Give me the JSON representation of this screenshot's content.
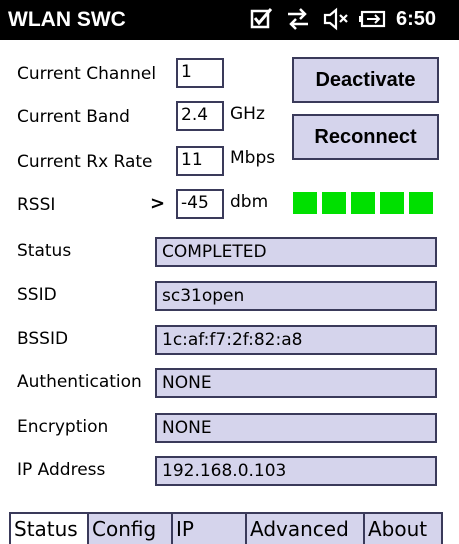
{
  "titlebar": {
    "title": "WLAN SWC",
    "icons": [
      "checkbox-checked-icon",
      "network-arrows-icon",
      "speaker-muted-icon",
      "battery-charging-icon"
    ],
    "time": "6:50"
  },
  "fields": {
    "current_channel": {
      "label": "Current Channel",
      "value": "1"
    },
    "current_band": {
      "label": "Current Band",
      "value": "2.4",
      "unit": "GHz"
    },
    "current_rx_rate": {
      "label": "Current Rx Rate",
      "value": "11",
      "unit": "Mbps"
    },
    "rssi": {
      "label": "RSSI",
      "comparator": ">",
      "value": "-45",
      "unit": "dbm",
      "bars_lit": 5,
      "bars_total": 5
    }
  },
  "buttons": {
    "deactivate": "Deactivate",
    "reconnect": "Reconnect"
  },
  "status_rows": [
    {
      "label": "Status",
      "value": "COMPLETED"
    },
    {
      "label": "SSID",
      "value": "sc31open"
    },
    {
      "label": "BSSID",
      "value": "1c:af:f7:2f:82:a8"
    },
    {
      "label": "Authentication",
      "value": "NONE"
    },
    {
      "label": "Encryption",
      "value": "NONE"
    },
    {
      "label": "IP Address",
      "value": "192.168.0.103"
    }
  ],
  "tabs": [
    "Status",
    "Config",
    "IP",
    "Advanced",
    "About"
  ],
  "active_tab": "Status",
  "colors": {
    "titlebar_bg": "#000000",
    "field_bg": "#d5d4ec",
    "border": "#3a3a5a",
    "signal_on": "#00e000"
  }
}
